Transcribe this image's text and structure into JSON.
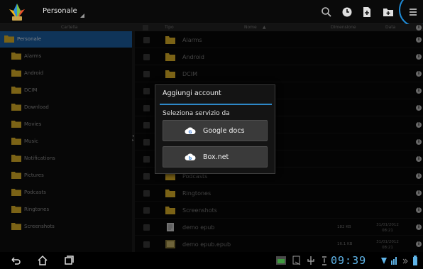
{
  "app": {
    "title": "Personale"
  },
  "columns": {
    "folder": "Cartella",
    "type": "Tipo",
    "name": "Nome",
    "size": "Dimensione",
    "date": "Data"
  },
  "tree": [
    {
      "label": "Personale",
      "selected": true
    },
    {
      "label": "Alarms"
    },
    {
      "label": "Android"
    },
    {
      "label": "DCIM"
    },
    {
      "label": "Download"
    },
    {
      "label": "Movies"
    },
    {
      "label": "Music"
    },
    {
      "label": "Notifications"
    },
    {
      "label": "Pictures"
    },
    {
      "label": "Podcasts"
    },
    {
      "label": "Ringtones"
    },
    {
      "label": "Screenshots"
    }
  ],
  "files": [
    {
      "name": "Alarms",
      "kind": "folder"
    },
    {
      "name": "Android",
      "kind": "folder"
    },
    {
      "name": "DCIM",
      "kind": "folder"
    },
    {
      "name": "",
      "kind": "folder"
    },
    {
      "name": "",
      "kind": "folder"
    },
    {
      "name": "",
      "kind": "folder"
    },
    {
      "name": "",
      "kind": "folder"
    },
    {
      "name": "",
      "kind": "folder"
    },
    {
      "name": "Podcasts",
      "kind": "folder"
    },
    {
      "name": "Ringtones",
      "kind": "folder"
    },
    {
      "name": "Screenshots",
      "kind": "folder"
    },
    {
      "name": "demo epub",
      "kind": "file",
      "size": "182 KB",
      "date": "31/01/2012",
      "time": "08:21"
    },
    {
      "name": "demo epub.epub",
      "kind": "epub",
      "size": "16.1 KB",
      "date": "31/01/2012",
      "time": "08:21"
    }
  ],
  "dialog": {
    "title": "Aggiungi account",
    "subtitle": "Seleziona servizio da",
    "services": [
      {
        "label": "Google docs",
        "icon": "google-docs-icon"
      },
      {
        "label": "Box.net",
        "icon": "box-net-icon"
      }
    ]
  },
  "system": {
    "clock": "09:39"
  },
  "colors": {
    "accent": "#2e88c8",
    "selection": "#1d5fa3",
    "folder": "#e0b428",
    "clock": "#5fb4e8"
  }
}
